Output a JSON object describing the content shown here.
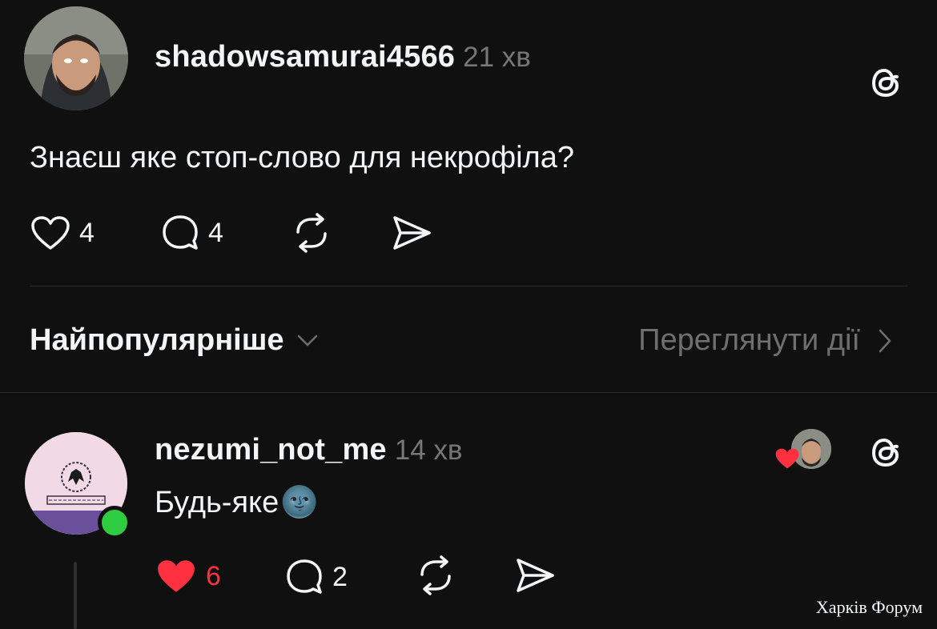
{
  "post": {
    "username": "shadowsamurai4566",
    "time": "21 хв",
    "text": "Знаєш яке стоп-слово для некрофіла?",
    "likes": "4",
    "replies": "4"
  },
  "sort": {
    "label": "Найпопулярніше",
    "view_activity": "Переглянути дії"
  },
  "reply": {
    "username": "nezumi_not_me",
    "time": "14 хв",
    "text": "Будь-яке",
    "emoji": "🌚",
    "likes": "6",
    "replies": "2",
    "liked": true,
    "online": true
  },
  "watermark": "Харків Форум",
  "colors": {
    "background": "#101010",
    "text": "#f3f5f7",
    "muted": "#777777",
    "like_red": "#ff3040",
    "online_green": "#2ecc40"
  },
  "icons": {
    "threads": "threads-logo-icon",
    "like": "heart-icon",
    "reply": "comment-icon",
    "repost": "repost-icon",
    "share": "share-icon"
  }
}
